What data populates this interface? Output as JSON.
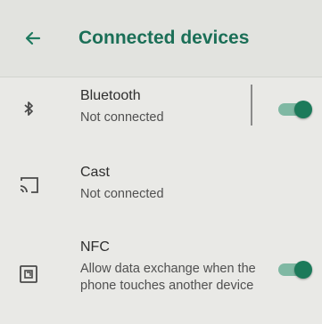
{
  "header": {
    "back_icon": "arrow-left-icon",
    "title": "Connected devices"
  },
  "items": [
    {
      "icon": "bluetooth-icon",
      "label": "Bluetooth",
      "sub": "Not connected",
      "toggle_on": true
    },
    {
      "icon": "cast-icon",
      "label": "Cast",
      "sub": "Not connected"
    },
    {
      "icon": "nfc-icon",
      "label": "NFC",
      "sub": "Allow data exchange when the phone touches another device",
      "toggle_on": true
    }
  ],
  "colors": {
    "accent": "#1c7a5a",
    "track": "#7fb8a3"
  }
}
